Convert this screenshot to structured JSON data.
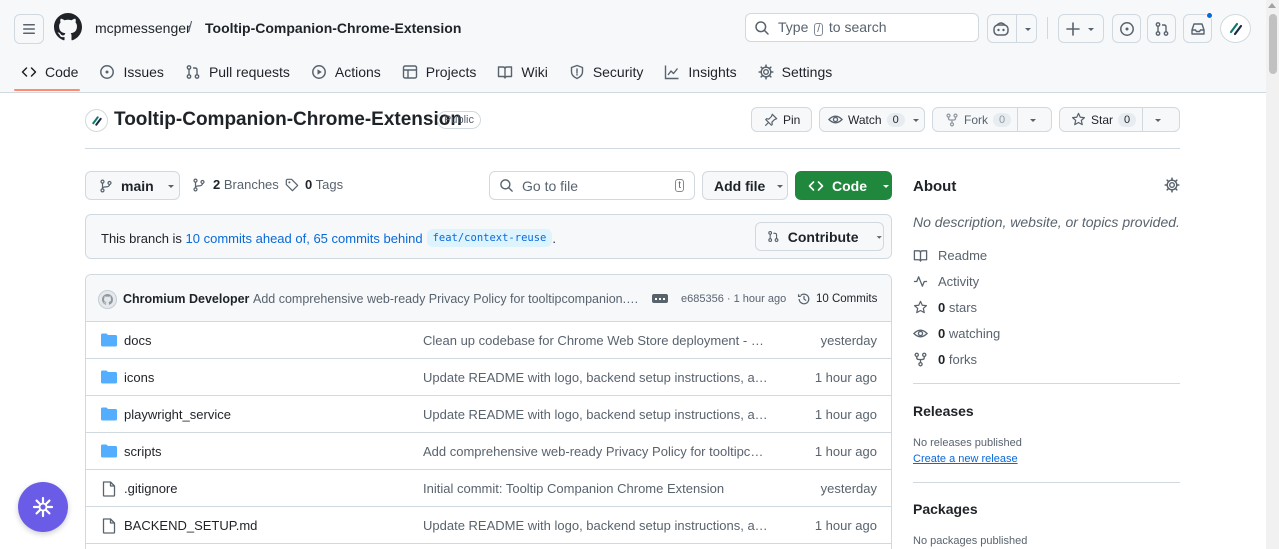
{
  "header": {
    "owner": "mcpmessenger",
    "separator": "/",
    "repo": "Tooltip-Companion-Chrome-Extension",
    "search": {
      "prefix": "Type",
      "key": "/",
      "suffix": "to search"
    }
  },
  "nav": {
    "tabs": [
      {
        "label": "Code",
        "icon": "code-icon"
      },
      {
        "label": "Issues",
        "icon": "issue-icon"
      },
      {
        "label": "Pull requests",
        "icon": "pull-request-icon"
      },
      {
        "label": "Actions",
        "icon": "play-icon"
      },
      {
        "label": "Projects",
        "icon": "table-icon"
      },
      {
        "label": "Wiki",
        "icon": "book-icon"
      },
      {
        "label": "Security",
        "icon": "shield-icon"
      },
      {
        "label": "Insights",
        "icon": "graph-icon"
      },
      {
        "label": "Settings",
        "icon": "gear-icon"
      }
    ]
  },
  "repo": {
    "title": "Tooltip-Companion-Chrome-Extension",
    "visibility": "Public",
    "pin_label": "Pin",
    "watch_label": "Watch",
    "watch_count": "0",
    "fork_label": "Fork",
    "fork_count": "0",
    "star_label": "Star",
    "star_count": "0"
  },
  "toolbar": {
    "branch": "main",
    "branches_count": "2",
    "branches_label": "Branches",
    "tags_count": "0",
    "tags_label": "Tags",
    "goto_placeholder": "Go to file",
    "goto_key": "t",
    "add_file_label": "Add file",
    "code_label": "Code"
  },
  "banner": {
    "prefix": "This branch is",
    "link": "10 commits ahead of, 65 commits behind",
    "branch_ref": "feat/context-reuse",
    "suffix": ".",
    "contribute_label": "Contribute"
  },
  "latest_commit": {
    "author": "Chromium Developer",
    "message": "Add comprehensive web-ready Privacy Policy for tooltipcompanion.com",
    "meta": "e685356 · 1 hour ago",
    "commits_label": "10 Commits"
  },
  "files": [
    {
      "name": "docs",
      "type": "dir",
      "message": "Clean up codebase for Chrome Web Store deployment - Organize docs",
      "age": "yesterday"
    },
    {
      "name": "icons",
      "type": "dir",
      "message": "Update README with logo, backend setup instructions, and screenshots",
      "age": "1 hour ago"
    },
    {
      "name": "playwright_service",
      "type": "dir",
      "message": "Update README with logo, backend setup instructions, and screenshots",
      "age": "1 hour ago"
    },
    {
      "name": "scripts",
      "type": "dir",
      "message": "Add comprehensive web-ready Privacy Policy for tooltipcompanion.com",
      "age": "1 hour ago"
    },
    {
      "name": ".gitignore",
      "type": "file",
      "message": "Initial commit: Tooltip Companion Chrome Extension",
      "age": "yesterday"
    },
    {
      "name": "BACKEND_SETUP.md",
      "type": "file",
      "message": "Update README with logo, backend setup instructions, and screenshots",
      "age": "1 hour ago"
    }
  ],
  "sidebar": {
    "about_title": "About",
    "about_desc": "No description, website, or topics provided.",
    "items": [
      {
        "label": "Readme",
        "count": "",
        "icon": "book-icon"
      },
      {
        "label": "Activity",
        "count": "",
        "icon": "pulse-icon"
      },
      {
        "label": "stars",
        "count": "0",
        "icon": "star-icon"
      },
      {
        "label": "watching",
        "count": "0",
        "icon": "eye-icon"
      },
      {
        "label": "forks",
        "count": "0",
        "icon": "fork-icon"
      }
    ],
    "releases_title": "Releases",
    "releases_none": "No releases published",
    "releases_link": "Create a new release",
    "packages_title": "Packages",
    "packages_none": "No packages published"
  },
  "colors": {
    "accent": "#0969da",
    "code_button": "#1f883d",
    "tab_underline": "#fd8c73",
    "fab": "#6b5ce7"
  }
}
